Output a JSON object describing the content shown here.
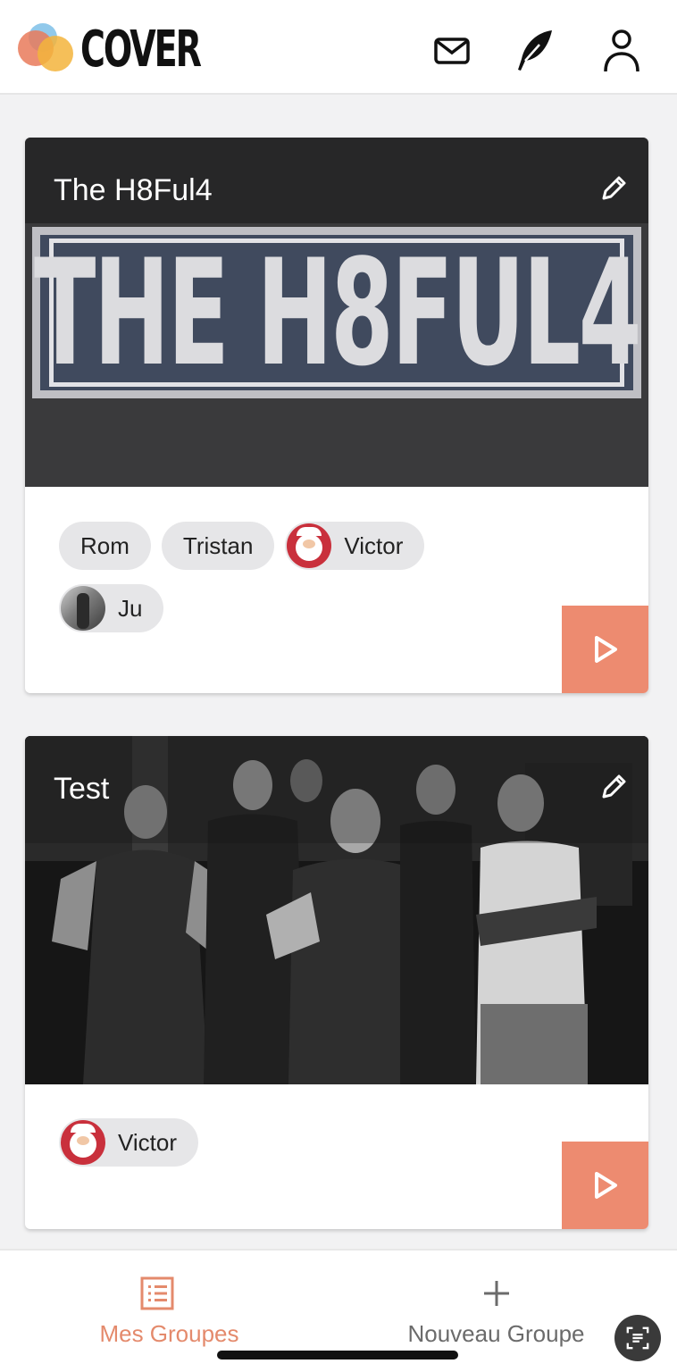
{
  "app": {
    "name": "COVER"
  },
  "colors": {
    "accent": "#ed8b70",
    "accent_text": "#e48a6c",
    "chip_bg": "#e6e6e8"
  },
  "header": {
    "icons": [
      "mail-icon",
      "feather-icon",
      "user-icon"
    ]
  },
  "groups": [
    {
      "title": "The H8Ful4",
      "banner_text": "THE H8FUL4",
      "members": [
        {
          "name": "Rom",
          "avatar": null
        },
        {
          "name": "Tristan",
          "avatar": null
        },
        {
          "name": "Victor",
          "avatar": "santa-avatar"
        },
        {
          "name": "Ju",
          "avatar": "photo-avatar"
        }
      ]
    },
    {
      "title": "Test",
      "members": [
        {
          "name": "Victor",
          "avatar": "santa-avatar"
        }
      ]
    }
  ],
  "bottom_nav": {
    "items": [
      {
        "label": "Mes Groupes",
        "icon": "list-icon",
        "active": true
      },
      {
        "label": "Nouveau Groupe",
        "icon": "plus-icon",
        "active": false
      }
    ]
  }
}
